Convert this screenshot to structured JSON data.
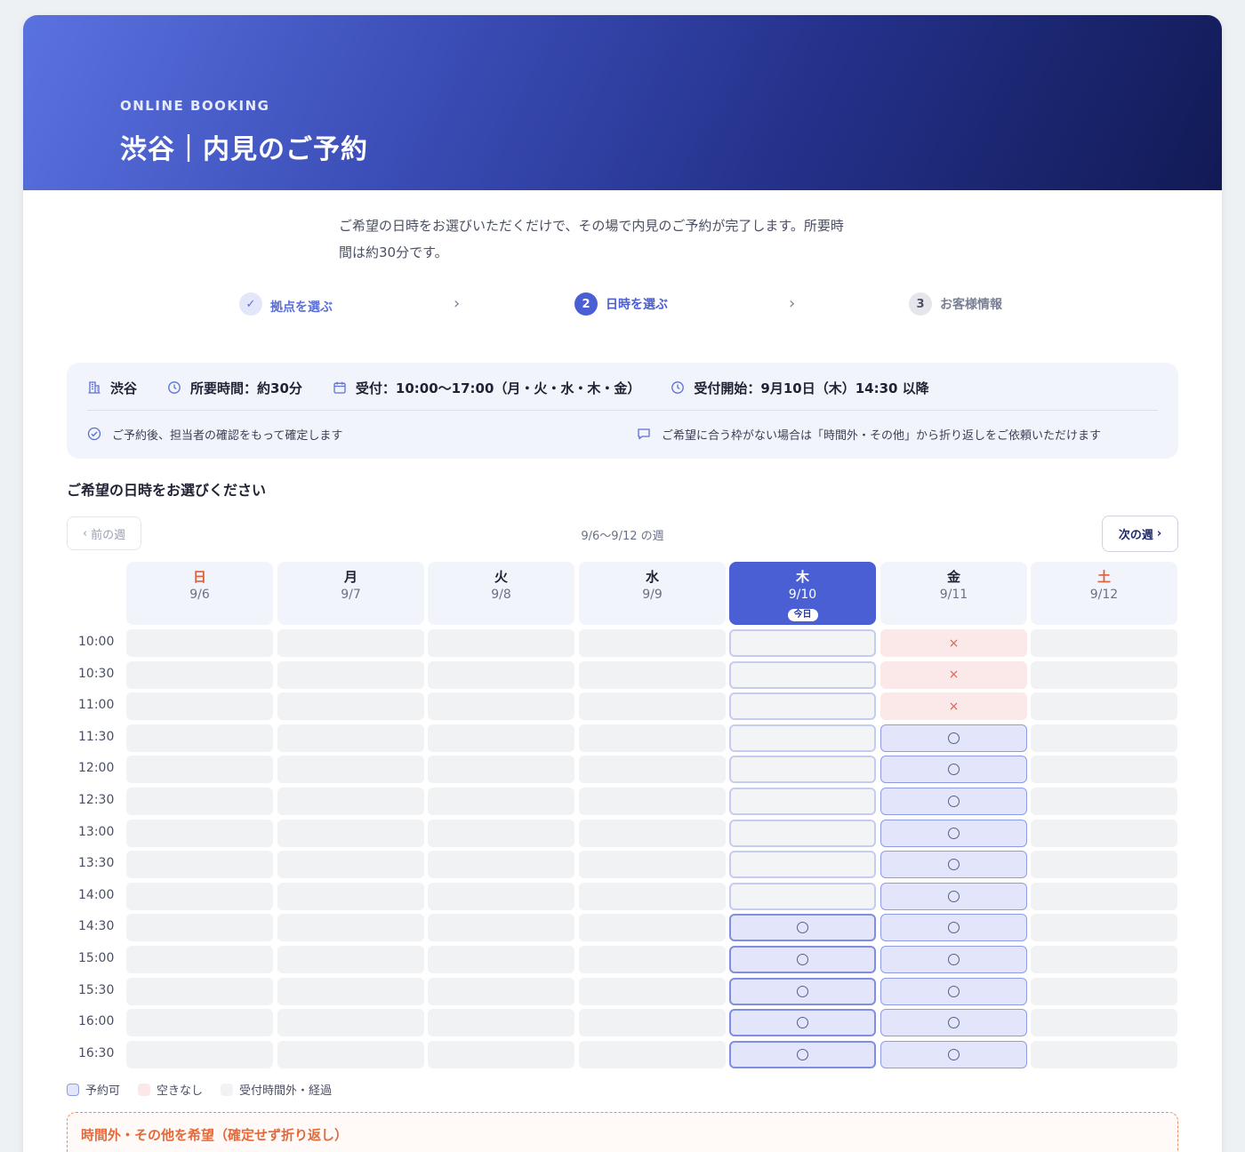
{
  "hero": {
    "eyebrow": "ONLINE BOOKING",
    "title": "渋谷｜内見のご予約"
  },
  "intro": {
    "line1": "ご希望の日時をお選びいただくだけで、その場で内見のご予約が完了します。所要時",
    "line2": "間は約30分です。"
  },
  "steps": [
    {
      "num": "✓",
      "label": "拠点を選ぶ",
      "state": "done"
    },
    {
      "num": "2",
      "label": "日時を選ぶ",
      "state": "current"
    },
    {
      "num": "3",
      "label": "お客様情報",
      "state": "upcoming"
    }
  ],
  "step_arrow": "›",
  "info": {
    "location": "渋谷",
    "duration": "所要時間：約30分",
    "hours": "受付：10:00〜17:00（月・火・水・木・金）",
    "start": "受付開始：9月10日（木）14:30 以降",
    "note_confirm": "ご予約後、担当者の確認をもって確定します",
    "note_other": "ご希望に合う枠がない場合は「時間外・その他」から折り返しをご依頼いただけます"
  },
  "section_title": "ご希望の日時をお選びください",
  "week_nav": {
    "prev": "前の週",
    "next": "次の週",
    "label": "9/6〜9/12 の週",
    "prev_chevron": "‹",
    "next_chevron": "›"
  },
  "days": [
    {
      "dow": "日",
      "date": "9/6",
      "kind": "sun"
    },
    {
      "dow": "月",
      "date": "9/7",
      "kind": "weekday"
    },
    {
      "dow": "火",
      "date": "9/8",
      "kind": "weekday"
    },
    {
      "dow": "水",
      "date": "9/9",
      "kind": "weekday"
    },
    {
      "dow": "木",
      "date": "9/10",
      "kind": "today",
      "badge": "今日"
    },
    {
      "dow": "金",
      "date": "9/11",
      "kind": "weekday"
    },
    {
      "dow": "土",
      "date": "9/12",
      "kind": "sat"
    }
  ],
  "times": [
    "10:00",
    "10:30",
    "11:00",
    "11:30",
    "12:00",
    "12:30",
    "13:00",
    "13:30",
    "14:00",
    "14:30",
    "15:00",
    "15:30",
    "16:00",
    "16:30"
  ],
  "slots": {
    "thu": [
      "none",
      "none",
      "none",
      "none",
      "none",
      "none",
      "none",
      "none",
      "none",
      "avail",
      "avail",
      "avail",
      "avail",
      "avail"
    ],
    "fri": [
      "full",
      "full",
      "full",
      "avail",
      "avail",
      "avail",
      "avail",
      "avail",
      "avail",
      "avail",
      "avail",
      "avail",
      "avail",
      "avail"
    ]
  },
  "marks": {
    "full": "×",
    "avail": "○"
  },
  "legend": [
    {
      "label": "予約可",
      "color": "#e3e6fa",
      "border": "#8e9be6"
    },
    {
      "label": "空きなし",
      "color": "#fbe9ea",
      "border": "#fbe9ea"
    },
    {
      "label": "受付時間外・経過",
      "color": "#f1f2f3",
      "border": "#f1f2f3"
    }
  ],
  "other_request": {
    "title": "時間外・その他を希望（確定せず折り返し）"
  },
  "colors": {
    "accent": "#4b5fd4",
    "orange": "#e46a3c",
    "full": "#e0604f"
  }
}
